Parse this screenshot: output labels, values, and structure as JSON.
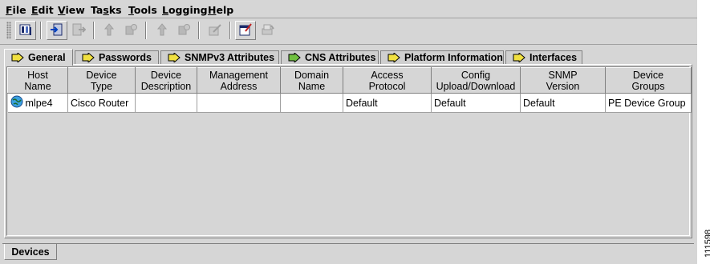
{
  "menu": [
    "File",
    "Edit",
    "View",
    "Tasks",
    "Tools",
    "Logging",
    "Help"
  ],
  "menu_mnemonics": [
    "F",
    "E",
    "V",
    "s",
    "T",
    "L",
    "H"
  ],
  "tabs": [
    "General",
    "Passwords",
    "SNMPv3 Attributes",
    "CNS Attributes",
    "Platform Information",
    "Interfaces"
  ],
  "active_tab": "General",
  "columns": [
    [
      "Host",
      "Name"
    ],
    [
      "Device",
      "Type"
    ],
    [
      "Device",
      "Description"
    ],
    [
      "Management",
      "Address"
    ],
    [
      "Domain",
      "Name"
    ],
    [
      "Access",
      "Protocol"
    ],
    [
      "Config",
      "Upload/Download"
    ],
    [
      "SNMP",
      "Version"
    ],
    [
      "Device",
      "Groups"
    ]
  ],
  "rows": [
    [
      "mlpe4",
      "Cisco Router",
      "",
      "",
      "",
      "Default",
      "Default",
      "Default",
      "PE Device Group"
    ]
  ],
  "bottom_tab": "Devices",
  "figure_id": "111598",
  "icons": {
    "toolbar": [
      "device-list-icon",
      "add-device-icon",
      "export-device-icon",
      "move-up-icon",
      "delete-device-icon",
      "move-up-icon",
      "delete-device-icon",
      "edit-icon",
      "properties-icon",
      "print-icon"
    ],
    "tab": "pencil-arrow-icon",
    "row": "device-globe-icon"
  },
  "colors": {
    "window_bg": "#d6d6d6",
    "tab_icon_fill": "#f0e040",
    "cell_bg": "#ffffff"
  }
}
